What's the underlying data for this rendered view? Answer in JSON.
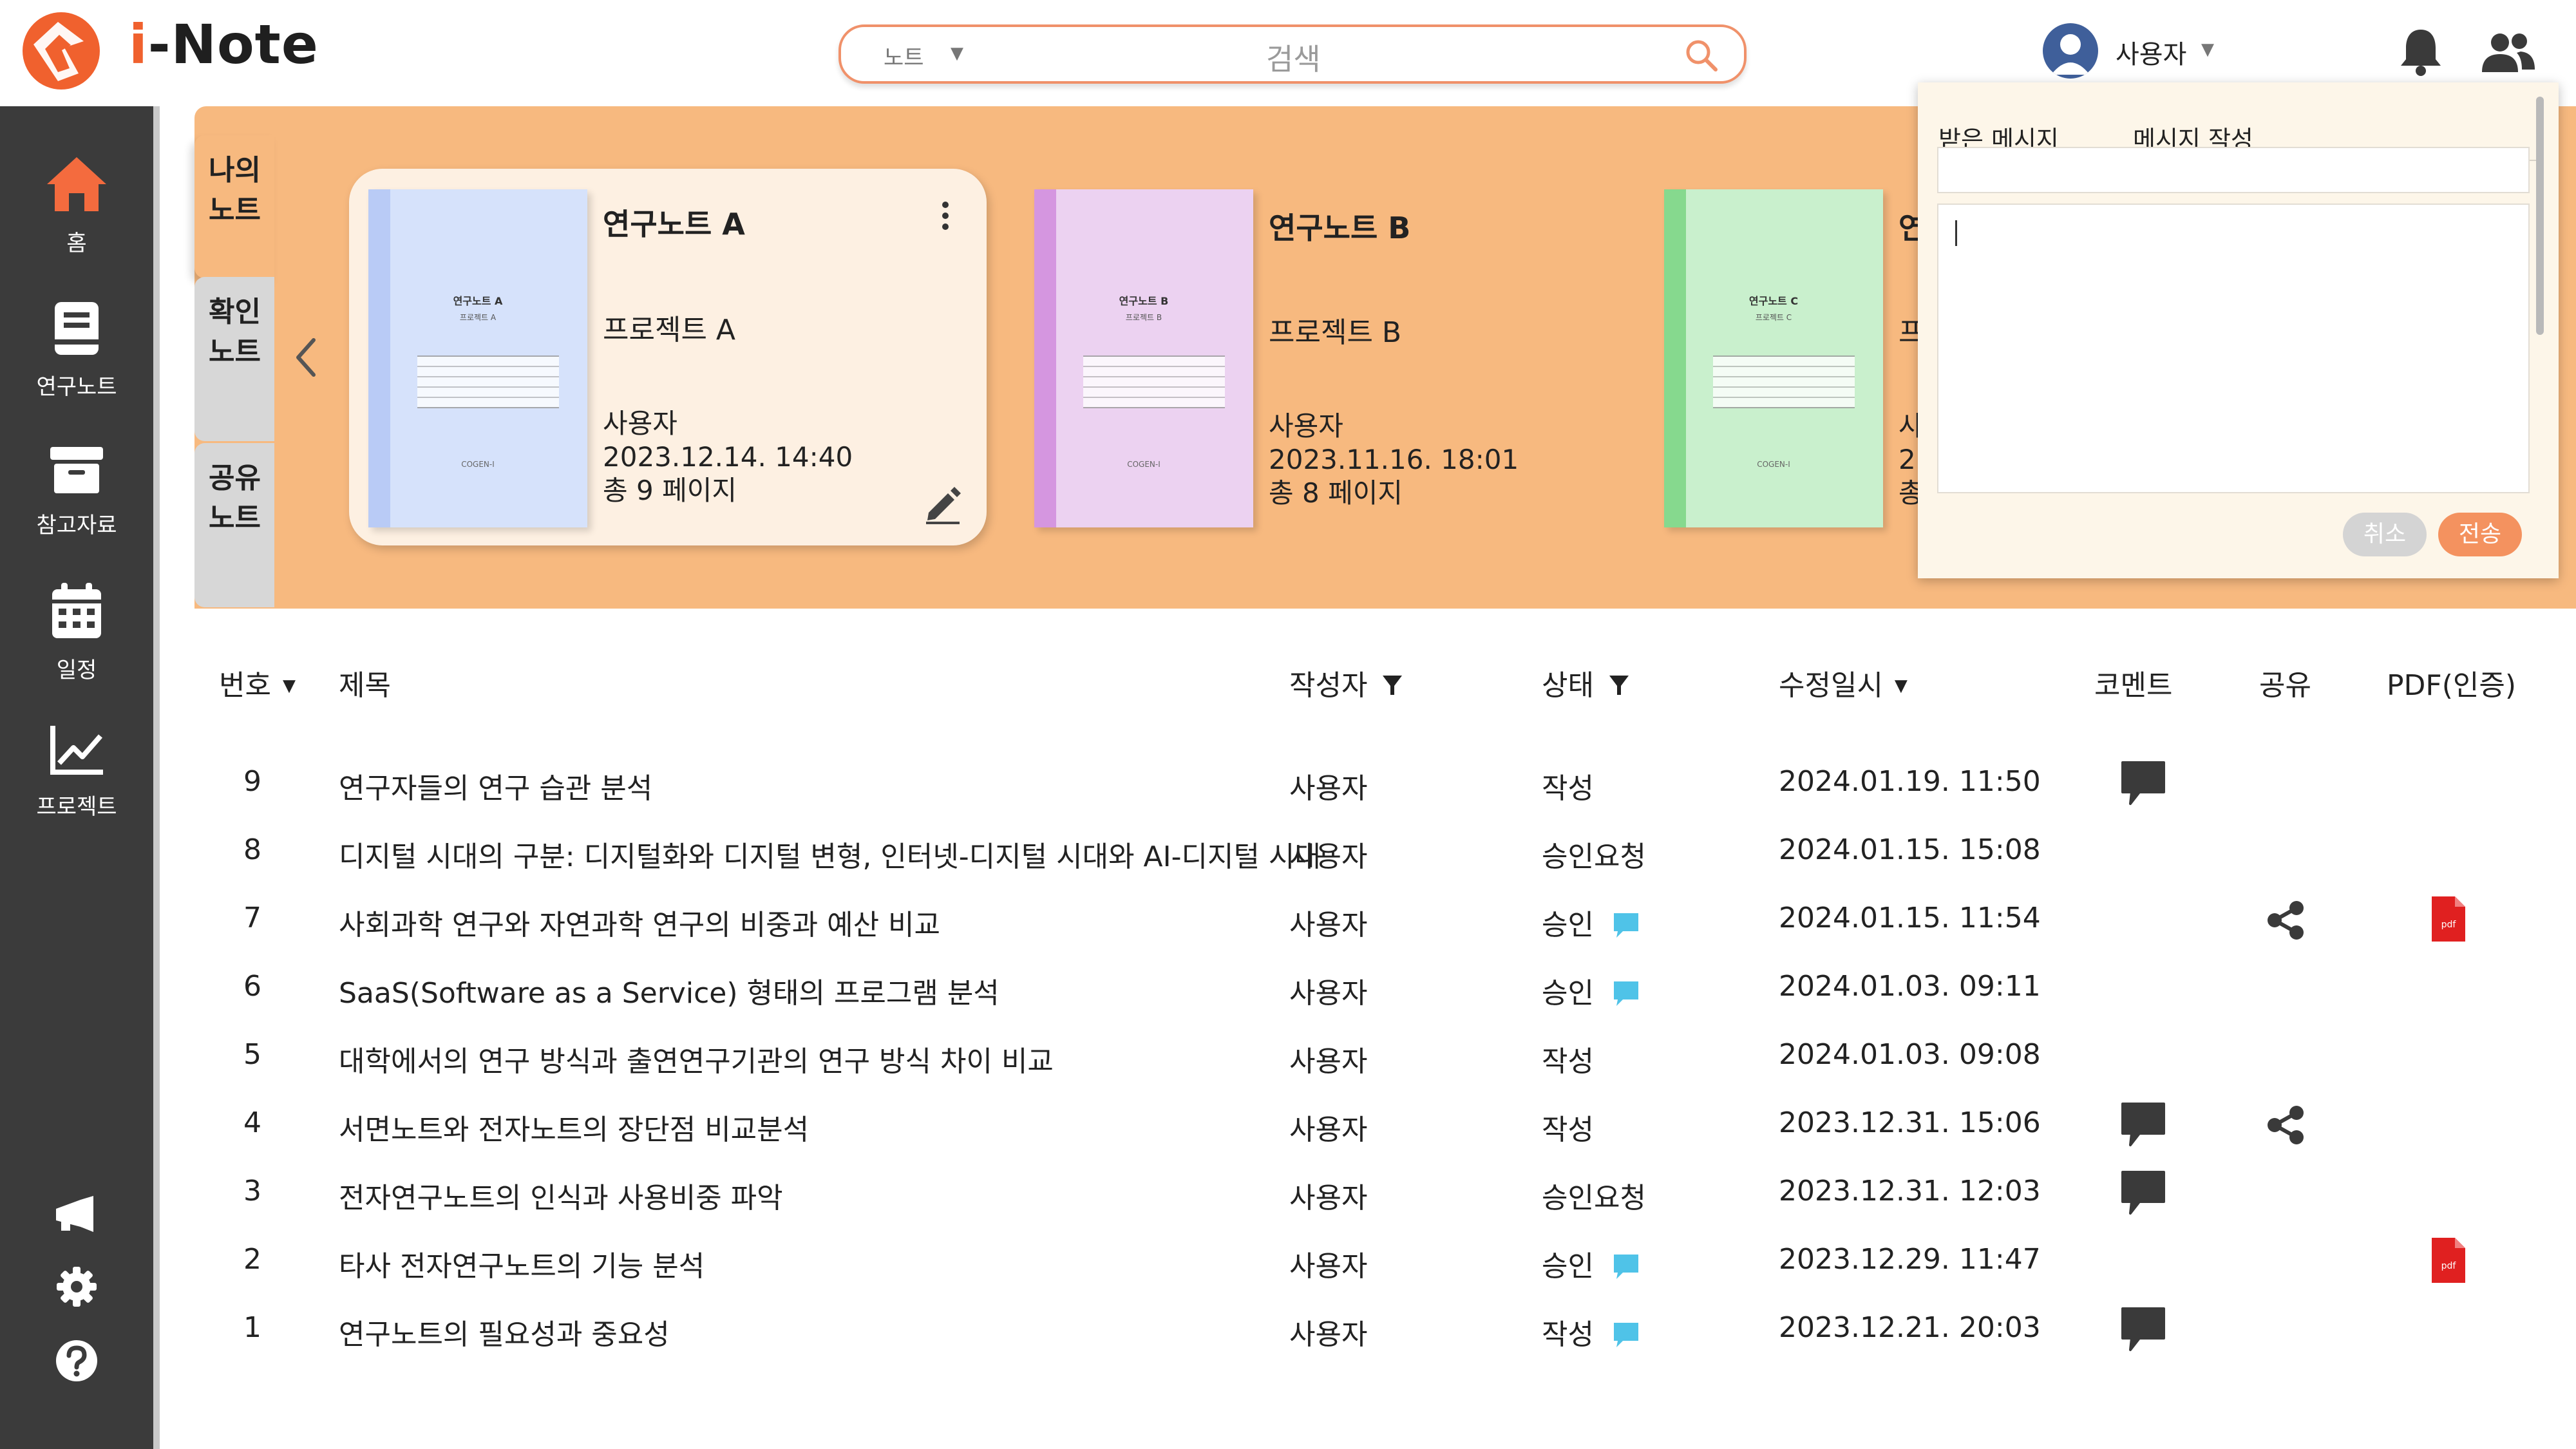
{
  "app": {
    "brand_i": "i",
    "brand_rest": "-Note"
  },
  "search": {
    "scope": "노트",
    "placeholder": "검색"
  },
  "user": {
    "name": "사용자"
  },
  "sidebar": {
    "items": [
      {
        "label": "홈",
        "icon": "home-icon"
      },
      {
        "label": "연구노트",
        "icon": "notebook-icon"
      },
      {
        "label": "참고자료",
        "icon": "archive-icon"
      },
      {
        "label": "일정",
        "icon": "calendar-icon"
      },
      {
        "label": "프로젝트",
        "icon": "chart-line-icon"
      }
    ],
    "bottom": [
      "megaphone-icon",
      "gear-icon",
      "help-icon"
    ]
  },
  "note_tabs": [
    {
      "line1": "나의",
      "line2": "노트"
    },
    {
      "line1": "확인",
      "line2": "노트"
    },
    {
      "line1": "공유",
      "line2": "노트"
    }
  ],
  "note_cards": [
    {
      "title": "연구노트 A",
      "project": "프로젝트 A",
      "author": "사용자",
      "datetime": "2023.12.14.  14:40",
      "pages": "총 9 페이지",
      "cover_title": "연구노트 A",
      "cover_sub": "프로젝트 A",
      "cover_brand": "COGEN-I",
      "color": "#d6e2fb",
      "spine": "#b9cbf6"
    },
    {
      "title": "연구노트 B",
      "project": "프로젝트 B",
      "author": "사용자",
      "datetime": "2023.11.16.  18:01",
      "pages": "총 8 페이지",
      "cover_title": "연구노트 B",
      "cover_sub": "프로젝트 B",
      "cover_brand": "COGEN-I",
      "color": "#ecd2f1",
      "spine": "#d596e0"
    },
    {
      "title": "연",
      "project": "프",
      "author": "사",
      "datetime": "2",
      "pages": "총",
      "cover_title": "연구노트 C",
      "cover_sub": "프로젝트 C",
      "cover_brand": "COGEN-I",
      "color": "#c9f0cd",
      "spine": "#86d98e"
    }
  ],
  "message": {
    "tab_inbox": "받은 메시지",
    "tab_compose": "메시지 작성",
    "cancel": "취소",
    "send": "전송"
  },
  "table": {
    "headers": {
      "num": "번호",
      "title": "제목",
      "author": "작성자",
      "status": "상태",
      "modified": "수정일시",
      "comment": "코멘트",
      "share": "공유",
      "pdf": "PDF(인증)"
    },
    "rows": [
      {
        "num": "9",
        "title": "연구자들의 연구 습관 분석",
        "author": "사용자",
        "status": "작성",
        "status_bubble": false,
        "date": "2024.01.19. 11:50",
        "comment": true,
        "share": false,
        "pdf": false
      },
      {
        "num": "8",
        "title": "디지털 시대의 구분: 디지털화와 디지털 변형, 인터넷-디지털 시대와 AI-디지털 시대",
        "author": "사용자",
        "status": "승인요청",
        "status_bubble": false,
        "date": "2024.01.15. 15:08",
        "comment": false,
        "share": false,
        "pdf": false
      },
      {
        "num": "7",
        "title": "사회과학 연구와 자연과학 연구의 비중과 예산 비교",
        "author": "사용자",
        "status": "승인",
        "status_bubble": true,
        "date": "2024.01.15. 11:54",
        "comment": false,
        "share": true,
        "pdf": true
      },
      {
        "num": "6",
        "title": "SaaS(Software as a Service) 형태의 프로그램 분석",
        "author": "사용자",
        "status": "승인",
        "status_bubble": true,
        "date": "2024.01.03. 09:11",
        "comment": false,
        "share": false,
        "pdf": false
      },
      {
        "num": "5",
        "title": "대학에서의 연구 방식과 출연연구기관의 연구 방식 차이 비교",
        "author": "사용자",
        "status": "작성",
        "status_bubble": false,
        "date": "2024.01.03. 09:08",
        "comment": false,
        "share": false,
        "pdf": false
      },
      {
        "num": "4",
        "title": "서면노트와 전자노트의 장단점 비교분석",
        "author": "사용자",
        "status": "작성",
        "status_bubble": false,
        "date": "2023.12.31. 15:06",
        "comment": true,
        "share": true,
        "pdf": false
      },
      {
        "num": "3",
        "title": "전자연구노트의 인식과 사용비중 파악",
        "author": "사용자",
        "status": "승인요청",
        "status_bubble": false,
        "date": "2023.12.31. 12:03",
        "comment": true,
        "share": false,
        "pdf": false
      },
      {
        "num": "2",
        "title": "타사 전자연구노트의 기능 분석",
        "author": "사용자",
        "status": "승인",
        "status_bubble": true,
        "date": "2023.12.29. 11:47",
        "comment": false,
        "share": false,
        "pdf": true
      },
      {
        "num": "1",
        "title": "연구노트의 필요성과 중요성",
        "author": "사용자",
        "status": "작성",
        "status_bubble": true,
        "date": "2023.12.21. 20:03",
        "comment": true,
        "share": false,
        "pdf": false
      }
    ]
  },
  "colors": {
    "accent": "#f0612e",
    "banner": "#f7b97f",
    "sidebar": "#3b3b3b",
    "send": "#f4925f",
    "status_bubble": "#4fc3e8"
  }
}
